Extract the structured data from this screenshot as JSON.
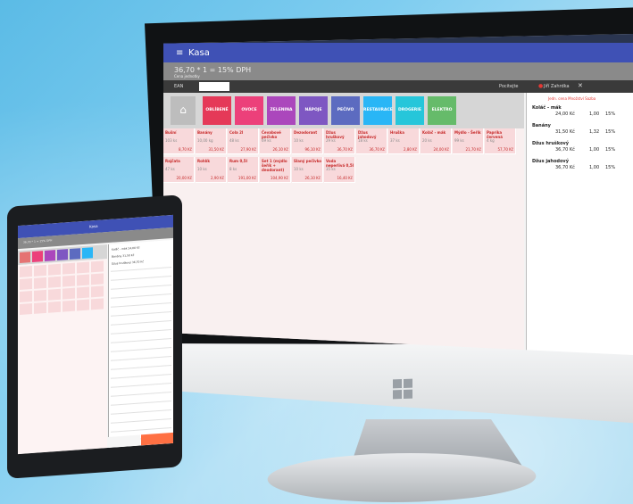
{
  "app": {
    "title": "Kasa",
    "total_line": "36,70 * 1 = 15% DPH",
    "sub_line": "Cena jednotky",
    "ean_label": "EAN",
    "position_label": "Pocitejte",
    "user_name": "Jiří Zahrdka"
  },
  "categories": [
    {
      "label": "OBLÍBENÉ",
      "color": "#e53958"
    },
    {
      "label": "OVOCE",
      "color": "#ec407a"
    },
    {
      "label": "ZELENINA",
      "color": "#ab47bc"
    },
    {
      "label": "NÁPOJE",
      "color": "#7e57c2"
    },
    {
      "label": "PEČIVO",
      "color": "#5c6bc0"
    },
    {
      "label": "RESTAURACE",
      "color": "#29b6f6"
    },
    {
      "label": "DROGERIE",
      "color": "#26c6da"
    },
    {
      "label": "ELEKTRO",
      "color": "#66bb6a"
    }
  ],
  "products": [
    {
      "name": "Bušní",
      "qty": "103 ks",
      "price": "8,70 Kč"
    },
    {
      "name": "Banány",
      "qty": "10,00 kg",
      "price": "31,50 Kč"
    },
    {
      "name": "Cola 2l",
      "qty": "48 ks",
      "price": "27,90 Kč"
    },
    {
      "name": "Čevabové pečivko",
      "qty": "69 ks",
      "price": "26,10 Kč"
    },
    {
      "name": "Dezodorant",
      "qty": "10 ks",
      "price": "96,10 Kč"
    },
    {
      "name": "Džus hruškový",
      "qty": "29 ks",
      "price": "36,70 Kč"
    },
    {
      "name": "Džus jahodový",
      "qty": "18 ks",
      "price": "36,70 Kč"
    },
    {
      "name": "Hruška",
      "qty": "37 ks",
      "price": "2,80 Kč"
    },
    {
      "name": "Koláč - mák",
      "qty": "20 ks",
      "price": "24,00 Kč"
    },
    {
      "name": "Mýdlo - Šeřík",
      "qty": "99 ks",
      "price": "21,70 Kč"
    },
    {
      "name": "Paprika červená",
      "qty": "4 kg",
      "price": "57,70 Kč"
    },
    {
      "name": "Rajčata",
      "qty": "47 ks",
      "price": "20,00 Kč"
    },
    {
      "name": "Rohlík",
      "qty": "10 ks",
      "price": "2,90 Kč"
    },
    {
      "name": "Rum 0,5l",
      "qty": "8 ks",
      "price": "191,00 Kč"
    },
    {
      "name": "Set 1 (mýdlo šeřík + deodorant)",
      "qty": "",
      "price": "104,90 Kč"
    },
    {
      "name": "Slaný pečivko",
      "qty": "10 ks",
      "price": "26,10 Kč"
    },
    {
      "name": "Voda neperlivá 0,5l",
      "qty": "35 ks",
      "price": "16,40 Kč"
    }
  ],
  "receipt": {
    "header": "Jedn. cena  Množství  Sazba",
    "items": [
      {
        "name": "Koláč - mák",
        "price": "24,00 Kč",
        "qty": "1,00",
        "vat": "15%"
      },
      {
        "name": "Banány",
        "price": "31,50 Kč",
        "qty": "1,32",
        "vat": "15%"
      },
      {
        "name": "Džus hruškový",
        "price": "36,70 Kč",
        "qty": "1,00",
        "vat": "15%"
      },
      {
        "name": "Džus jahodový",
        "price": "36,70 Kč",
        "qty": "1,00",
        "vat": "15%"
      }
    ]
  },
  "tablet": {
    "title": "Kasa",
    "total_line": "36,70 * 1 = 15% DPH",
    "cat_colors": [
      "#e57373",
      "#ec407a",
      "#ab47bc",
      "#7e57c2",
      "#5c6bc0",
      "#29b6f6"
    ],
    "receipt_lines": [
      "Koláč - mák 24,00 Kč",
      "Banány 31,50 Kč",
      "Džus hruškový 36,70 Kč"
    ]
  }
}
